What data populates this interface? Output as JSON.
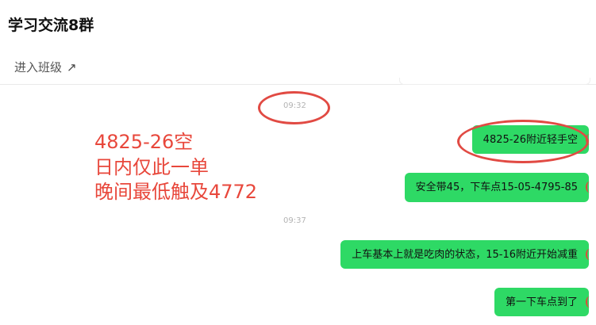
{
  "header": {
    "title": "学习交流8群",
    "enter_class_label": "进入班级",
    "enter_class_icon": "arrow-up-right-icon"
  },
  "messages": [
    {
      "time": "09:32"
    },
    {
      "text": "4825-26附近轻手空"
    },
    {
      "text": "安全带45，下车点15-05-4795-85"
    },
    {
      "time": "09:37"
    },
    {
      "text": "上车基本上就是吃肉的状态，15-16附近开始减重"
    },
    {
      "text": "第一下车点到了"
    }
  ],
  "annotation": {
    "lines": [
      "4825-26空",
      "日内仅此一单",
      "晚间最低触及4772"
    ],
    "color": "#e8473b"
  },
  "colors": {
    "bubble": "#2ed965",
    "annotation_circle": "#e14a43",
    "timestamp": "#b3b3b3"
  }
}
